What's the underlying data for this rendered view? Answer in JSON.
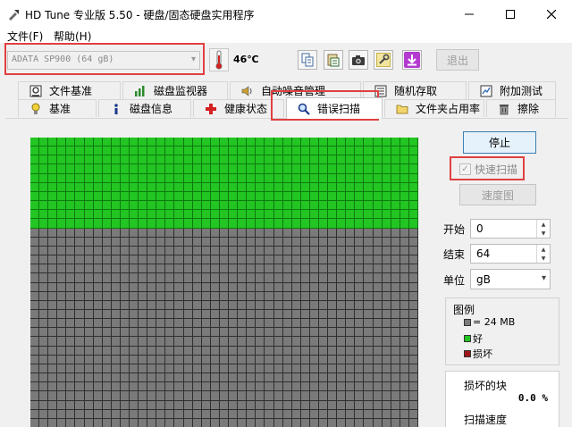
{
  "window": {
    "title": "HD Tune 专业版 5.50 - 硬盘/固态硬盘实用程序"
  },
  "menu": {
    "file": "文件(F)",
    "help": "帮助(H)"
  },
  "toolbar": {
    "drive": "ADATA SP900 (64 gB)",
    "temperature": "46℃",
    "exit_label": "退出",
    "icons": [
      "copy-icon",
      "paste-icon",
      "camera-icon",
      "wrench-icon",
      "download-icon"
    ]
  },
  "tabs": {
    "row1": [
      "文件基准",
      "磁盘监视器",
      "自动噪音管理",
      "随机存取",
      "附加测试"
    ],
    "row2": [
      "基准",
      "磁盘信息",
      "健康状态",
      "错误扫描",
      "文件夹占用率",
      "擦除"
    ],
    "active": "错误扫描"
  },
  "scan": {
    "stop_label": "停止",
    "quick_scan_label": "快速扫描",
    "quick_scan_checked": true,
    "speed_map_label": "速度图",
    "start_label": "开始",
    "start_value": "0",
    "end_label": "结束",
    "end_value": "64",
    "unit_label": "单位",
    "unit_value": "gB",
    "progress_fraction": 0.24
  },
  "legend": {
    "title": "图例",
    "block_size": "= 24 MB",
    "good": "好",
    "bad": "损坏"
  },
  "stats": {
    "damaged_label": "损坏的块",
    "damaged_value": "0.0 %",
    "speed_label": "扫描速度"
  },
  "colors": {
    "good": "#22c522",
    "bad": "#a01818",
    "unscanned": "#7a7a7a",
    "annotation": "#e04040"
  }
}
